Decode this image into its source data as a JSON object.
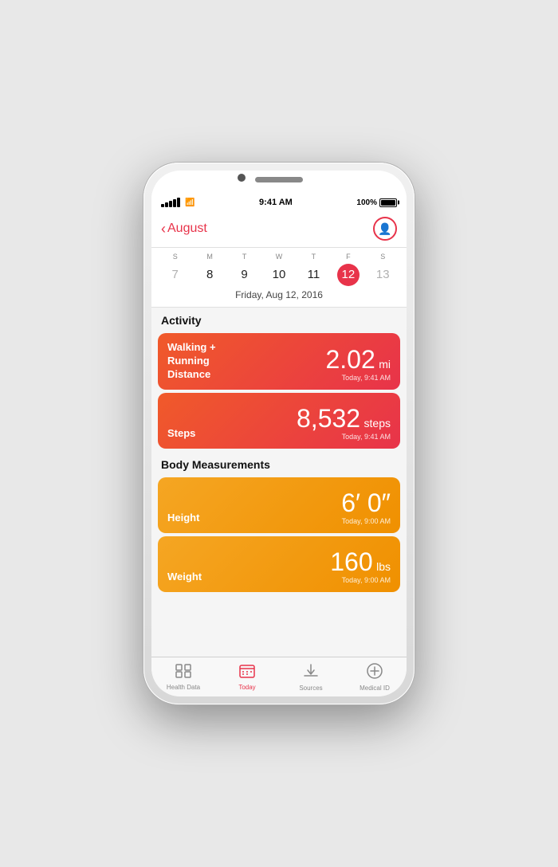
{
  "phone": {
    "status": {
      "time": "9:41 AM",
      "battery": "100%"
    },
    "header": {
      "back_label": "August",
      "profile_icon": "👤"
    },
    "calendar": {
      "day_headers": [
        "S",
        "M",
        "T",
        "W",
        "T",
        "F",
        "S"
      ],
      "days": [
        {
          "label": "7",
          "type": "gray"
        },
        {
          "label": "8",
          "type": "normal"
        },
        {
          "label": "9",
          "type": "normal"
        },
        {
          "label": "10",
          "type": "normal"
        },
        {
          "label": "11",
          "type": "normal"
        },
        {
          "label": "12",
          "type": "selected"
        },
        {
          "label": "13",
          "type": "gray"
        }
      ],
      "date_label": "Friday, Aug 12, 2016"
    },
    "sections": [
      {
        "title": "Activity",
        "cards": [
          {
            "label": "Walking + Running Distance",
            "value": "2.02",
            "unit": "mi",
            "time": "Today, 9:41 AM",
            "color": "red"
          },
          {
            "label": "Steps",
            "value": "8,532",
            "unit": "steps",
            "time": "Today, 9:41 AM",
            "color": "red"
          }
        ]
      },
      {
        "title": "Body Measurements",
        "cards": [
          {
            "label": "Height",
            "value": "6′ 0″",
            "unit": "",
            "time": "Today, 9:00 AM",
            "color": "orange"
          },
          {
            "label": "Weight",
            "value": "160",
            "unit": "lbs",
            "time": "Today, 9:00 AM",
            "color": "orange"
          }
        ]
      }
    ],
    "tabs": [
      {
        "label": "Health Data",
        "icon": "⊞",
        "active": false
      },
      {
        "label": "Today",
        "icon": "▦",
        "active": true
      },
      {
        "label": "Sources",
        "icon": "⬇",
        "active": false
      },
      {
        "label": "Medical ID",
        "icon": "✳",
        "active": false
      }
    ]
  }
}
